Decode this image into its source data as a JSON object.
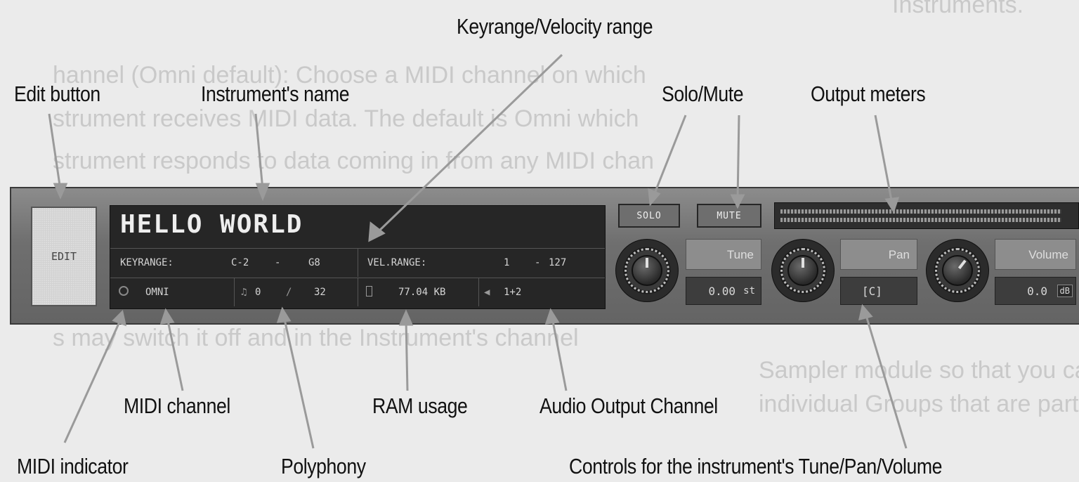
{
  "background_text": [
    "Instruments.",
    "hannel (Omni default): Choose a MIDI channel on which",
    "strument receives MIDI data. The default is Omni which",
    "strument responds to data coming in from any MIDI chan",
    "s may switch it off and in the Instrument's channel",
    "Sampler module so that you can choose a MIDI channel",
    "individual Groups that are part of the Instrument."
  ],
  "callouts": {
    "keyrange_velocity": "Keyrange/Velocity range",
    "edit_button": "Edit button",
    "instrument_name": "Instrument's name",
    "solo_mute": "Solo/Mute",
    "output_meters": "Output meters",
    "midi_channel": "MIDI channel",
    "ram_usage": "RAM usage",
    "audio_output": "Audio Output Channel",
    "midi_indicator": "MIDI indicator",
    "polyphony": "Polyphony",
    "controls": "Controls for the instrument's Tune/Pan/Volume"
  },
  "plugin": {
    "edit_label": "EDIT",
    "instrument_name": "HELLO WORLD",
    "keyrange_label": "KEYRANGE:",
    "keyrange_low": "C-2",
    "keyrange_sep": "-",
    "keyrange_high": "G8",
    "velrange_label": "VEL.RANGE:",
    "vel_low": "1",
    "vel_sep": "-",
    "vel_high": "127",
    "midi_channel": "OMNI",
    "polyphony_current": "0",
    "polyphony_max": "32",
    "ram": "77.04 KB",
    "audio_output": "1+2",
    "solo_label": "SOLO",
    "mute_label": "MUTE",
    "tune_label": "Tune",
    "tune_value": "0.00",
    "tune_unit": "st",
    "pan_label": "Pan",
    "pan_value": "[C]",
    "volume_label": "Volume",
    "volume_value": "0.0",
    "volume_unit": "dB"
  }
}
